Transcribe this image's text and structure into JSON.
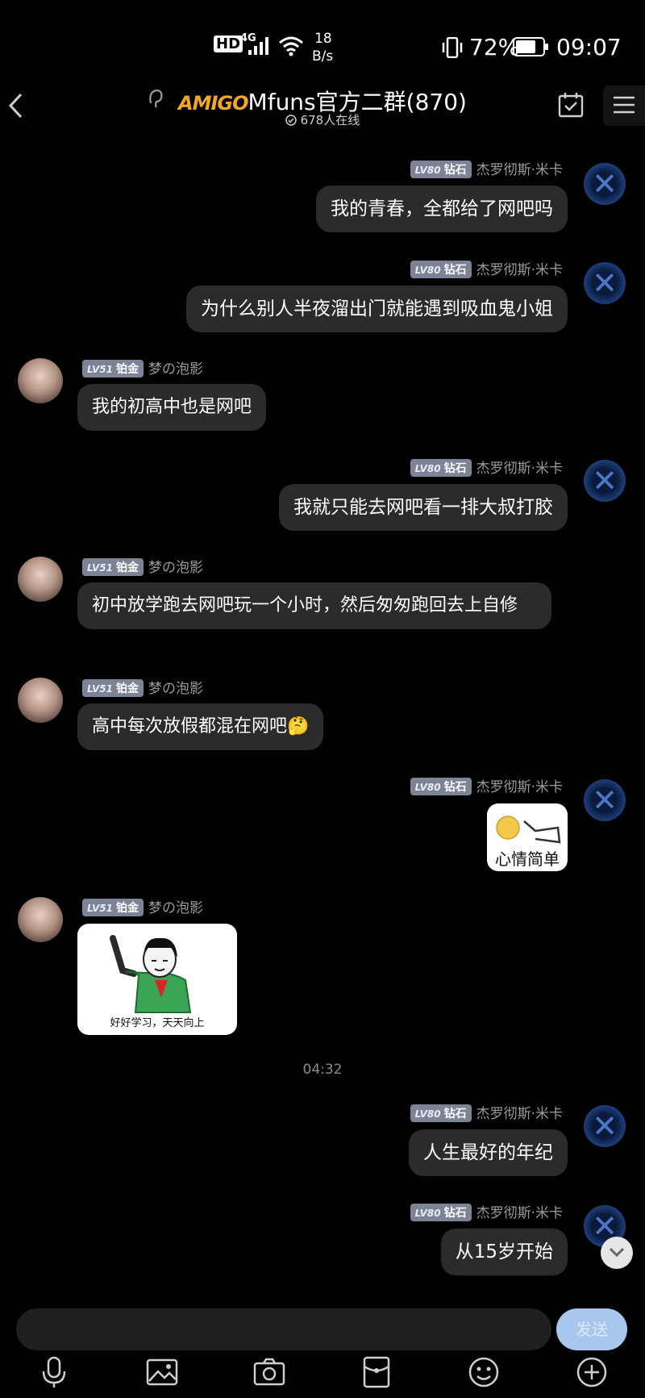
{
  "status_bar": {
    "hd": "HD",
    "network": "4G",
    "speed_value": "18",
    "speed_unit": "B/s",
    "battery": "72%",
    "time": "09:07"
  },
  "header": {
    "logo_text": "AMIGO",
    "group_name": "Mfuns官方二群(870)",
    "online_count": "678人在线"
  },
  "messages": [
    {
      "side": "right",
      "level": "LV80",
      "rank": "钻石",
      "name": "杰罗彻斯·米卡",
      "text": "我的青春，全都给了网吧吗"
    },
    {
      "side": "right",
      "level": "LV80",
      "rank": "钻石",
      "name": "杰罗彻斯·米卡",
      "text": "为什么别人半夜溜出门就能遇到吸血鬼小姐"
    },
    {
      "side": "left",
      "level": "LV51",
      "rank": "铂金",
      "name": "梦の泡影",
      "text": "我的初高中也是网吧"
    },
    {
      "side": "right",
      "level": "LV80",
      "rank": "钻石",
      "name": "杰罗彻斯·米卡",
      "text": "我就只能去网吧看一排大叔打胶"
    },
    {
      "side": "left",
      "level": "LV51",
      "rank": "铂金",
      "name": "梦の泡影",
      "text": "初中放学跑去网吧玩一个小时，然后匆匆跑回去上自修"
    },
    {
      "side": "left",
      "level": "LV51",
      "rank": "铂金",
      "name": "梦の泡影",
      "text": "高中每次放假都混在网吧🤔"
    },
    {
      "side": "right",
      "level": "LV80",
      "rank": "钻石",
      "name": "杰罗彻斯·米卡",
      "sticker_caption": "心情简单"
    },
    {
      "side": "left",
      "level": "LV51",
      "rank": "铂金",
      "name": "梦の泡影",
      "sticker_caption": "好好学习，天天向上"
    },
    {
      "side": "right",
      "level": "LV80",
      "rank": "钻石",
      "name": "杰罗彻斯·米卡",
      "text": "人生最好的年纪"
    },
    {
      "side": "right",
      "level": "LV80",
      "rank": "钻石",
      "name": "杰罗彻斯·米卡",
      "text": "从15岁开始"
    }
  ],
  "timestamp": "04:32",
  "composer": {
    "send_label": "发送",
    "input_value": ""
  },
  "toolbar_icons": [
    "microphone-icon",
    "image-icon",
    "camera-icon",
    "red-packet-icon",
    "emoji-icon",
    "plus-icon"
  ],
  "colors": {
    "background": "#000000",
    "bubble": "#2b2b2b",
    "badge": "#7d8396",
    "send_button": "#a8c7ef"
  }
}
